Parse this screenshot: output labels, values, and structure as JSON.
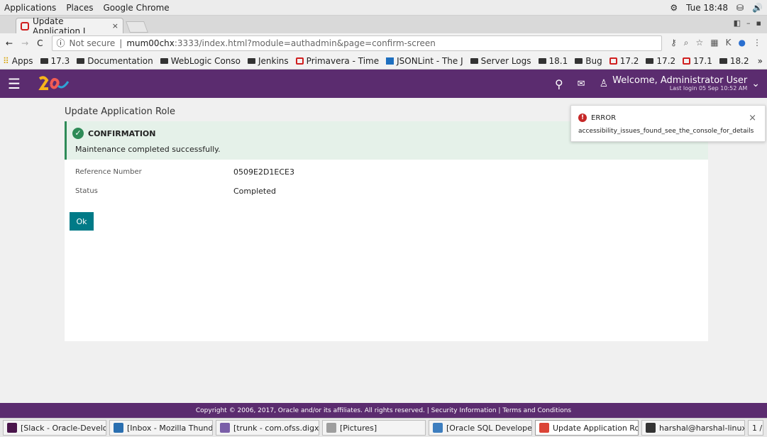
{
  "system": {
    "menus": [
      "Applications",
      "Places",
      "Google Chrome"
    ],
    "clock": "Tue 18:48"
  },
  "browser": {
    "tab_title": "Update Application I",
    "tab_close": "×",
    "not_secure": "Not secure",
    "url_host": "mum00chx",
    "url_rest": ":3333/index.html?module=authadmin&page=confirm-screen",
    "bookmarks": [
      {
        "label": "Apps",
        "icon": "apps-grid-icon"
      },
      {
        "label": "17.3",
        "icon": "folder-icon"
      },
      {
        "label": "Documentation",
        "icon": "folder-icon"
      },
      {
        "label": "WebLogic Conso",
        "icon": "folder-icon"
      },
      {
        "label": "Jenkins",
        "icon": "folder-icon"
      },
      {
        "label": "Primavera - Time",
        "icon": "oracle-icon"
      },
      {
        "label": "JSONLint - The J",
        "icon": "jsonlint-icon"
      },
      {
        "label": "Server Logs",
        "icon": "folder-icon"
      },
      {
        "label": "18.1",
        "icon": "folder-icon"
      },
      {
        "label": "Bug",
        "icon": "folder-icon"
      },
      {
        "label": "17.2",
        "icon": "oracle-icon"
      },
      {
        "label": "17.2",
        "icon": "folder-icon"
      },
      {
        "label": "17.1",
        "icon": "oracle-icon"
      },
      {
        "label": "18.2",
        "icon": "folder-icon"
      }
    ],
    "overflow": "»"
  },
  "app": {
    "welcome": "Welcome, Administrator User",
    "last_login": "Last login 05 Sep 10:52 AM",
    "page_title": "Update Application Role",
    "confirmation_title": "CONFIRMATION",
    "confirmation_message": "Maintenance completed successfully.",
    "fields": [
      {
        "label": "Reference Number",
        "value": "0509E2D1ECE3"
      },
      {
        "label": "Status",
        "value": "Completed"
      }
    ],
    "ok_label": "Ok",
    "footer": "Copyright © 2006, 2017, Oracle and/or its affiliates. All rights reserved. | Security Information | Terms and Conditions"
  },
  "toast": {
    "title": "ERROR",
    "message": "accessibility_issues_found_see_the_console_for_details",
    "close": "×"
  },
  "taskbar": [
    {
      "label": "[Slack - Oracle-Develo...",
      "color": "#4a154b"
    },
    {
      "label": "[Inbox - Mozilla Thund...",
      "color": "#2a6fb0"
    },
    {
      "label": "[trunk - com.ofss.digx...",
      "color": "#7a5ea8"
    },
    {
      "label": "[Pictures]",
      "color": "#9e9e9e"
    },
    {
      "label": "[Oracle SQL Developer...",
      "color": "#3d7ebf"
    },
    {
      "label": "Update Application Rol...",
      "color": "#db4437"
    },
    {
      "label": "harshal@harshal-linux:~",
      "color": "#333333"
    },
    {
      "label": "1 /",
      "color": ""
    }
  ],
  "colors": {
    "brand": "#5b2c6f",
    "success": "#2e8b57",
    "button": "#007a87",
    "error": "#c62828"
  }
}
